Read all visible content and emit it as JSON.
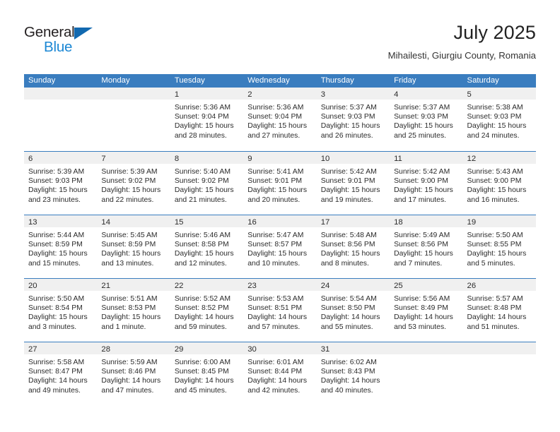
{
  "brand": {
    "name_top": "General",
    "name_bottom": "Blue",
    "triangle_color": "#1269b0",
    "blue_text_color": "#1b87d4"
  },
  "header": {
    "month_title": "July 2025",
    "location": "Mihailesti, Giurgiu County, Romania"
  },
  "theme": {
    "header_blue": "#3a7dbf",
    "day_band_gray": "#f0f0f0",
    "text_color": "#2b2b2b"
  },
  "weekdays": [
    "Sunday",
    "Monday",
    "Tuesday",
    "Wednesday",
    "Thursday",
    "Friday",
    "Saturday"
  ],
  "weeks": [
    [
      {
        "day": "",
        "empty": true,
        "sunrise": "",
        "sunset": "",
        "daylight_1": "",
        "daylight_2": ""
      },
      {
        "day": "",
        "empty": true,
        "sunrise": "",
        "sunset": "",
        "daylight_1": "",
        "daylight_2": ""
      },
      {
        "day": "1",
        "sunrise": "Sunrise: 5:36 AM",
        "sunset": "Sunset: 9:04 PM",
        "daylight_1": "Daylight: 15 hours",
        "daylight_2": "and 28 minutes."
      },
      {
        "day": "2",
        "sunrise": "Sunrise: 5:36 AM",
        "sunset": "Sunset: 9:04 PM",
        "daylight_1": "Daylight: 15 hours",
        "daylight_2": "and 27 minutes."
      },
      {
        "day": "3",
        "sunrise": "Sunrise: 5:37 AM",
        "sunset": "Sunset: 9:03 PM",
        "daylight_1": "Daylight: 15 hours",
        "daylight_2": "and 26 minutes."
      },
      {
        "day": "4",
        "sunrise": "Sunrise: 5:37 AM",
        "sunset": "Sunset: 9:03 PM",
        "daylight_1": "Daylight: 15 hours",
        "daylight_2": "and 25 minutes."
      },
      {
        "day": "5",
        "sunrise": "Sunrise: 5:38 AM",
        "sunset": "Sunset: 9:03 PM",
        "daylight_1": "Daylight: 15 hours",
        "daylight_2": "and 24 minutes."
      }
    ],
    [
      {
        "day": "6",
        "sunrise": "Sunrise: 5:39 AM",
        "sunset": "Sunset: 9:03 PM",
        "daylight_1": "Daylight: 15 hours",
        "daylight_2": "and 23 minutes."
      },
      {
        "day": "7",
        "sunrise": "Sunrise: 5:39 AM",
        "sunset": "Sunset: 9:02 PM",
        "daylight_1": "Daylight: 15 hours",
        "daylight_2": "and 22 minutes."
      },
      {
        "day": "8",
        "sunrise": "Sunrise: 5:40 AM",
        "sunset": "Sunset: 9:02 PM",
        "daylight_1": "Daylight: 15 hours",
        "daylight_2": "and 21 minutes."
      },
      {
        "day": "9",
        "sunrise": "Sunrise: 5:41 AM",
        "sunset": "Sunset: 9:01 PM",
        "daylight_1": "Daylight: 15 hours",
        "daylight_2": "and 20 minutes."
      },
      {
        "day": "10",
        "sunrise": "Sunrise: 5:42 AM",
        "sunset": "Sunset: 9:01 PM",
        "daylight_1": "Daylight: 15 hours",
        "daylight_2": "and 19 minutes."
      },
      {
        "day": "11",
        "sunrise": "Sunrise: 5:42 AM",
        "sunset": "Sunset: 9:00 PM",
        "daylight_1": "Daylight: 15 hours",
        "daylight_2": "and 17 minutes."
      },
      {
        "day": "12",
        "sunrise": "Sunrise: 5:43 AM",
        "sunset": "Sunset: 9:00 PM",
        "daylight_1": "Daylight: 15 hours",
        "daylight_2": "and 16 minutes."
      }
    ],
    [
      {
        "day": "13",
        "sunrise": "Sunrise: 5:44 AM",
        "sunset": "Sunset: 8:59 PM",
        "daylight_1": "Daylight: 15 hours",
        "daylight_2": "and 15 minutes."
      },
      {
        "day": "14",
        "sunrise": "Sunrise: 5:45 AM",
        "sunset": "Sunset: 8:59 PM",
        "daylight_1": "Daylight: 15 hours",
        "daylight_2": "and 13 minutes."
      },
      {
        "day": "15",
        "sunrise": "Sunrise: 5:46 AM",
        "sunset": "Sunset: 8:58 PM",
        "daylight_1": "Daylight: 15 hours",
        "daylight_2": "and 12 minutes."
      },
      {
        "day": "16",
        "sunrise": "Sunrise: 5:47 AM",
        "sunset": "Sunset: 8:57 PM",
        "daylight_1": "Daylight: 15 hours",
        "daylight_2": "and 10 minutes."
      },
      {
        "day": "17",
        "sunrise": "Sunrise: 5:48 AM",
        "sunset": "Sunset: 8:56 PM",
        "daylight_1": "Daylight: 15 hours",
        "daylight_2": "and 8 minutes."
      },
      {
        "day": "18",
        "sunrise": "Sunrise: 5:49 AM",
        "sunset": "Sunset: 8:56 PM",
        "daylight_1": "Daylight: 15 hours",
        "daylight_2": "and 7 minutes."
      },
      {
        "day": "19",
        "sunrise": "Sunrise: 5:50 AM",
        "sunset": "Sunset: 8:55 PM",
        "daylight_1": "Daylight: 15 hours",
        "daylight_2": "and 5 minutes."
      }
    ],
    [
      {
        "day": "20",
        "sunrise": "Sunrise: 5:50 AM",
        "sunset": "Sunset: 8:54 PM",
        "daylight_1": "Daylight: 15 hours",
        "daylight_2": "and 3 minutes."
      },
      {
        "day": "21",
        "sunrise": "Sunrise: 5:51 AM",
        "sunset": "Sunset: 8:53 PM",
        "daylight_1": "Daylight: 15 hours",
        "daylight_2": "and 1 minute."
      },
      {
        "day": "22",
        "sunrise": "Sunrise: 5:52 AM",
        "sunset": "Sunset: 8:52 PM",
        "daylight_1": "Daylight: 14 hours",
        "daylight_2": "and 59 minutes."
      },
      {
        "day": "23",
        "sunrise": "Sunrise: 5:53 AM",
        "sunset": "Sunset: 8:51 PM",
        "daylight_1": "Daylight: 14 hours",
        "daylight_2": "and 57 minutes."
      },
      {
        "day": "24",
        "sunrise": "Sunrise: 5:54 AM",
        "sunset": "Sunset: 8:50 PM",
        "daylight_1": "Daylight: 14 hours",
        "daylight_2": "and 55 minutes."
      },
      {
        "day": "25",
        "sunrise": "Sunrise: 5:56 AM",
        "sunset": "Sunset: 8:49 PM",
        "daylight_1": "Daylight: 14 hours",
        "daylight_2": "and 53 minutes."
      },
      {
        "day": "26",
        "sunrise": "Sunrise: 5:57 AM",
        "sunset": "Sunset: 8:48 PM",
        "daylight_1": "Daylight: 14 hours",
        "daylight_2": "and 51 minutes."
      }
    ],
    [
      {
        "day": "27",
        "sunrise": "Sunrise: 5:58 AM",
        "sunset": "Sunset: 8:47 PM",
        "daylight_1": "Daylight: 14 hours",
        "daylight_2": "and 49 minutes."
      },
      {
        "day": "28",
        "sunrise": "Sunrise: 5:59 AM",
        "sunset": "Sunset: 8:46 PM",
        "daylight_1": "Daylight: 14 hours",
        "daylight_2": "and 47 minutes."
      },
      {
        "day": "29",
        "sunrise": "Sunrise: 6:00 AM",
        "sunset": "Sunset: 8:45 PM",
        "daylight_1": "Daylight: 14 hours",
        "daylight_2": "and 45 minutes."
      },
      {
        "day": "30",
        "sunrise": "Sunrise: 6:01 AM",
        "sunset": "Sunset: 8:44 PM",
        "daylight_1": "Daylight: 14 hours",
        "daylight_2": "and 42 minutes."
      },
      {
        "day": "31",
        "sunrise": "Sunrise: 6:02 AM",
        "sunset": "Sunset: 8:43 PM",
        "daylight_1": "Daylight: 14 hours",
        "daylight_2": "and 40 minutes."
      },
      {
        "day": "",
        "empty": true,
        "sunrise": "",
        "sunset": "",
        "daylight_1": "",
        "daylight_2": ""
      },
      {
        "day": "",
        "empty": true,
        "sunrise": "",
        "sunset": "",
        "daylight_1": "",
        "daylight_2": ""
      }
    ]
  ]
}
